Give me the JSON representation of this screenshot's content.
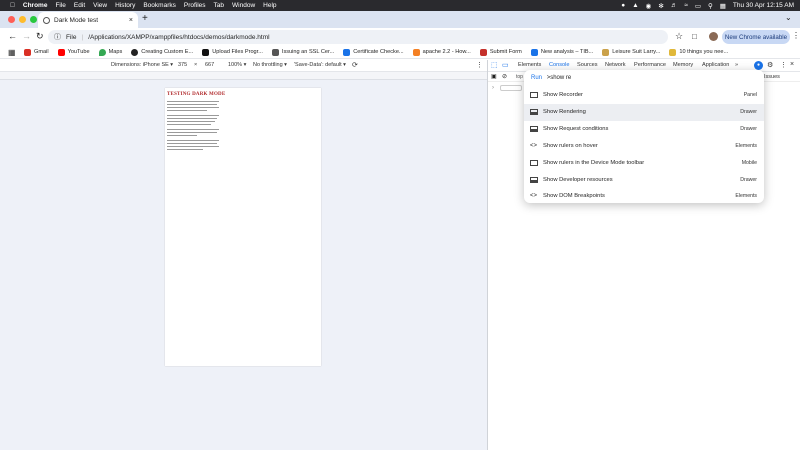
{
  "menubar": {
    "app": "Chrome",
    "items": [
      "File",
      "Edit",
      "View",
      "History",
      "Bookmarks",
      "Profiles",
      "Tab",
      "Window",
      "Help"
    ],
    "clock": "Thu 30 Apr  12:15 AM"
  },
  "tab": {
    "title": "Dark Mode test"
  },
  "address": {
    "scheme_label": "File",
    "url": "/Applications/XAMPP/xamppfiles/htdocs/demos/darkmode.html"
  },
  "new_chrome": "New Chrome available",
  "bookmarks": [
    {
      "label": "Gmail",
      "color": "#d93025"
    },
    {
      "label": "YouTube",
      "color": "#ff0000"
    },
    {
      "label": "Maps",
      "color": "#34a853"
    },
    {
      "label": "Creating Custom E...",
      "color": "#222222"
    },
    {
      "label": "Upload Files Progr...",
      "color": "#111111"
    },
    {
      "label": "Issuing an SSL Cer...",
      "color": "#555555"
    },
    {
      "label": "Certificate Checke...",
      "color": "#1a73e8"
    },
    {
      "label": "apache 2.2 - How...",
      "color": "#f48024"
    },
    {
      "label": "Submit Form",
      "color": "#c4302b"
    },
    {
      "label": "New analysis – TIB...",
      "color": "#1a73e8"
    },
    {
      "label": "Leisure Suit Larry...",
      "color": "#caa14a"
    },
    {
      "label": "10 things you nee...",
      "color": "#e0b83a"
    }
  ],
  "device_toolbar": {
    "dimensions": "Dimensions: iPhone SE",
    "width": "375",
    "times": "×",
    "height": "667",
    "zoom": "100%",
    "throttling": "No throttling",
    "save_data": "'Save-Data': default"
  },
  "page": {
    "heading": "TESTING DARK MODE"
  },
  "devtools": {
    "tabs": [
      "Elements",
      "Console",
      "Sources",
      "Network",
      "Performance",
      "Memory",
      "Application"
    ],
    "more": "»",
    "issues": "Issues",
    "console_hint": "top",
    "prompt_run": "Run",
    "prompt_query": ">show re"
  },
  "palette": {
    "items": [
      {
        "label": "Show Recorder",
        "category": "Panel",
        "icon": "panel-icon"
      },
      {
        "label": "Show Rendering",
        "category": "Drawer",
        "icon": "drawer-icon"
      },
      {
        "label": "Show Request conditions",
        "category": "Drawer",
        "icon": "drawer-icon"
      },
      {
        "label": "Show rulers on hover",
        "category": "Elements",
        "icon": "code-icon"
      },
      {
        "label": "Show rulers in the Device Mode toolbar",
        "category": "Mobile",
        "icon": "mobile-icon"
      },
      {
        "label": "Show Developer resources",
        "category": "Drawer",
        "icon": "drawer-icon"
      },
      {
        "label": "Show DOM Breakpoints",
        "category": "Elements",
        "icon": "code-icon"
      }
    ]
  },
  "colors": {
    "accent": "#1a73e8",
    "heading_red": "#b0282a",
    "tabstrip": "#dbe3f1",
    "viewport_bg": "#eef1f8"
  }
}
